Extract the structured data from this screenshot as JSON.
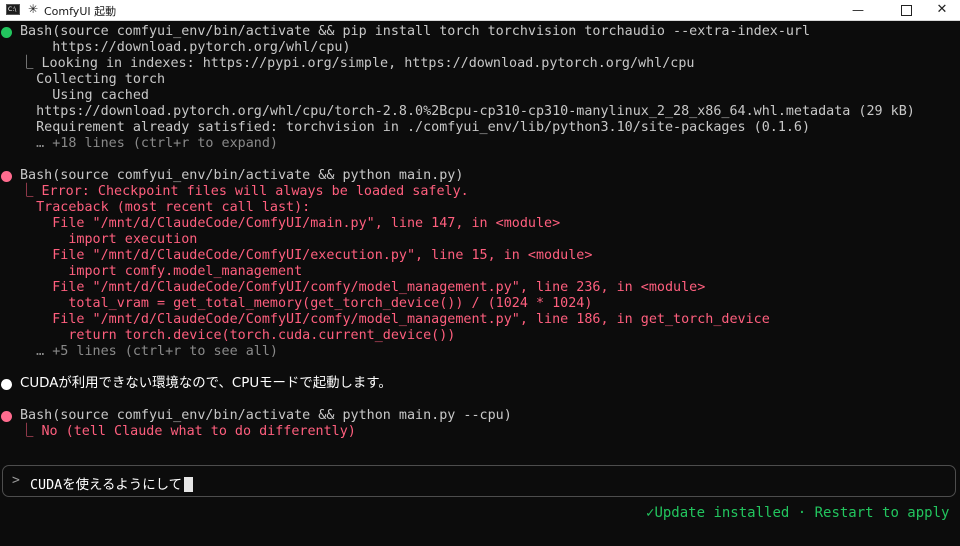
{
  "window": {
    "title": "ComfyUI 起動",
    "app_icon_text": "C:\\",
    "minimize_glyph": "—",
    "close_glyph": "✕"
  },
  "colors": {
    "success_bullet": "#22c55e",
    "error_bullet": "#ff6b8e",
    "message_bullet": "#ffffff",
    "error_text": "#ff5f7e",
    "status_text": "#22c55e"
  },
  "blocks": [
    {
      "command": "Bash(source comfyui_env/bin/activate && pip install torch torchvision torchaudio --extra-index-url",
      "command_cont": "    https://download.pytorch.org/whl/cpu)",
      "output": [
        "⎿ Looking in indexes: https://pypi.org/simple, https://download.pytorch.org/whl/cpu",
        "  Collecting torch",
        "    Using cached",
        "  https://download.pytorch.org/whl/cpu/torch-2.8.0%2Bcpu-cp310-cp310-manylinux_2_28_x86_64.whl.metadata (29 kB)",
        "  Requirement already satisfied: torchvision in ./comfyui_env/lib/python3.10/site-packages (0.1.6)",
        "  … +18 lines (ctrl+r to expand)"
      ]
    },
    {
      "command": "Bash(source comfyui_env/bin/activate && python main.py)",
      "output": [
        "⎿ Error: Checkpoint files will always be loaded safely.",
        "  Traceback (most recent call last):",
        "    File \"/mnt/d/ClaudeCode/ComfyUI/main.py\", line 147, in <module>",
        "      import execution",
        "    File \"/mnt/d/ClaudeCode/ComfyUI/execution.py\", line 15, in <module>",
        "      import comfy.model_management",
        "    File \"/mnt/d/ClaudeCode/ComfyUI/comfy/model_management.py\", line 236, in <module>",
        "      total_vram = get_total_memory(get_torch_device()) / (1024 * 1024)",
        "    File \"/mnt/d/ClaudeCode/ComfyUI/comfy/model_management.py\", line 186, in get_torch_device",
        "      return torch.device(torch.cuda.current_device())",
        "  … +5 lines (ctrl+r to see all)"
      ]
    },
    {
      "message": "CUDAが利用できない環境なので、CPUモードで起動します。"
    },
    {
      "command": "Bash(source comfyui_env/bin/activate && python main.py --cpu)",
      "output": [
        "⎿ No (tell Claude what to do differently)"
      ]
    }
  ],
  "input": {
    "prompt_symbol": ">",
    "value": "CUDAを使えるようにして"
  },
  "status": {
    "icon": "✓",
    "text": "Update installed · Restart to apply"
  }
}
